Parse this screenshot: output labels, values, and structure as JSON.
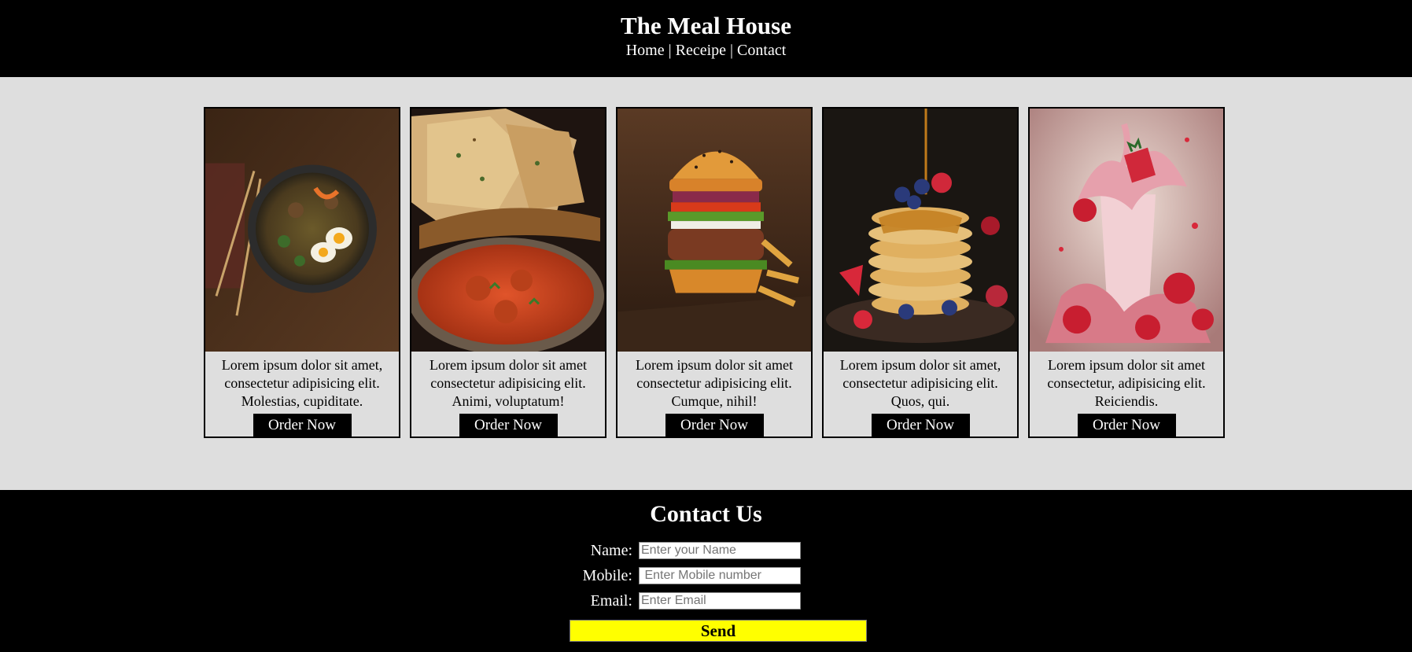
{
  "header": {
    "title": "The Meal House",
    "nav": [
      {
        "label": "Home"
      },
      {
        "label": "Receipe"
      },
      {
        "label": "Contact"
      }
    ],
    "separator": "|"
  },
  "cards": [
    {
      "image": "ramen-bowl-photo",
      "text": "Lorem ipsum dolor sit amet, consectetur adipisicing elit. Molestias, cupiditate.",
      "button": "Order Now"
    },
    {
      "image": "naan-curry-photo",
      "text": "Lorem ipsum dolor sit amet consectetur adipisicing elit. Animi, voluptatum!",
      "button": "Order Now"
    },
    {
      "image": "burger-photo",
      "text": "Lorem ipsum dolor sit amet consectetur adipisicing elit. Cumque, nihil!",
      "button": "Order Now"
    },
    {
      "image": "pancakes-photo",
      "text": "Lorem ipsum dolor sit amet, consectetur adipisicing elit. Quos, qui.",
      "button": "Order Now"
    },
    {
      "image": "strawberry-milkshake-photo",
      "text": "Lorem ipsum dolor sit amet consectetur, adipisicing elit. Reiciendis.",
      "button": "Order Now"
    }
  ],
  "contact": {
    "title": "Contact Us",
    "fields": [
      {
        "label": "Name:",
        "placeholder": "Enter your Name",
        "value": ""
      },
      {
        "label": "Mobile:",
        "placeholder": " Enter Mobile number",
        "value": ""
      },
      {
        "label": "Email:",
        "placeholder": "Enter Email",
        "value": ""
      }
    ],
    "send_label": "Send"
  },
  "colors": {
    "header_bg": "#000000",
    "main_bg": "#dedede",
    "button_bg": "#000000",
    "send_bg": "#ffff00"
  }
}
